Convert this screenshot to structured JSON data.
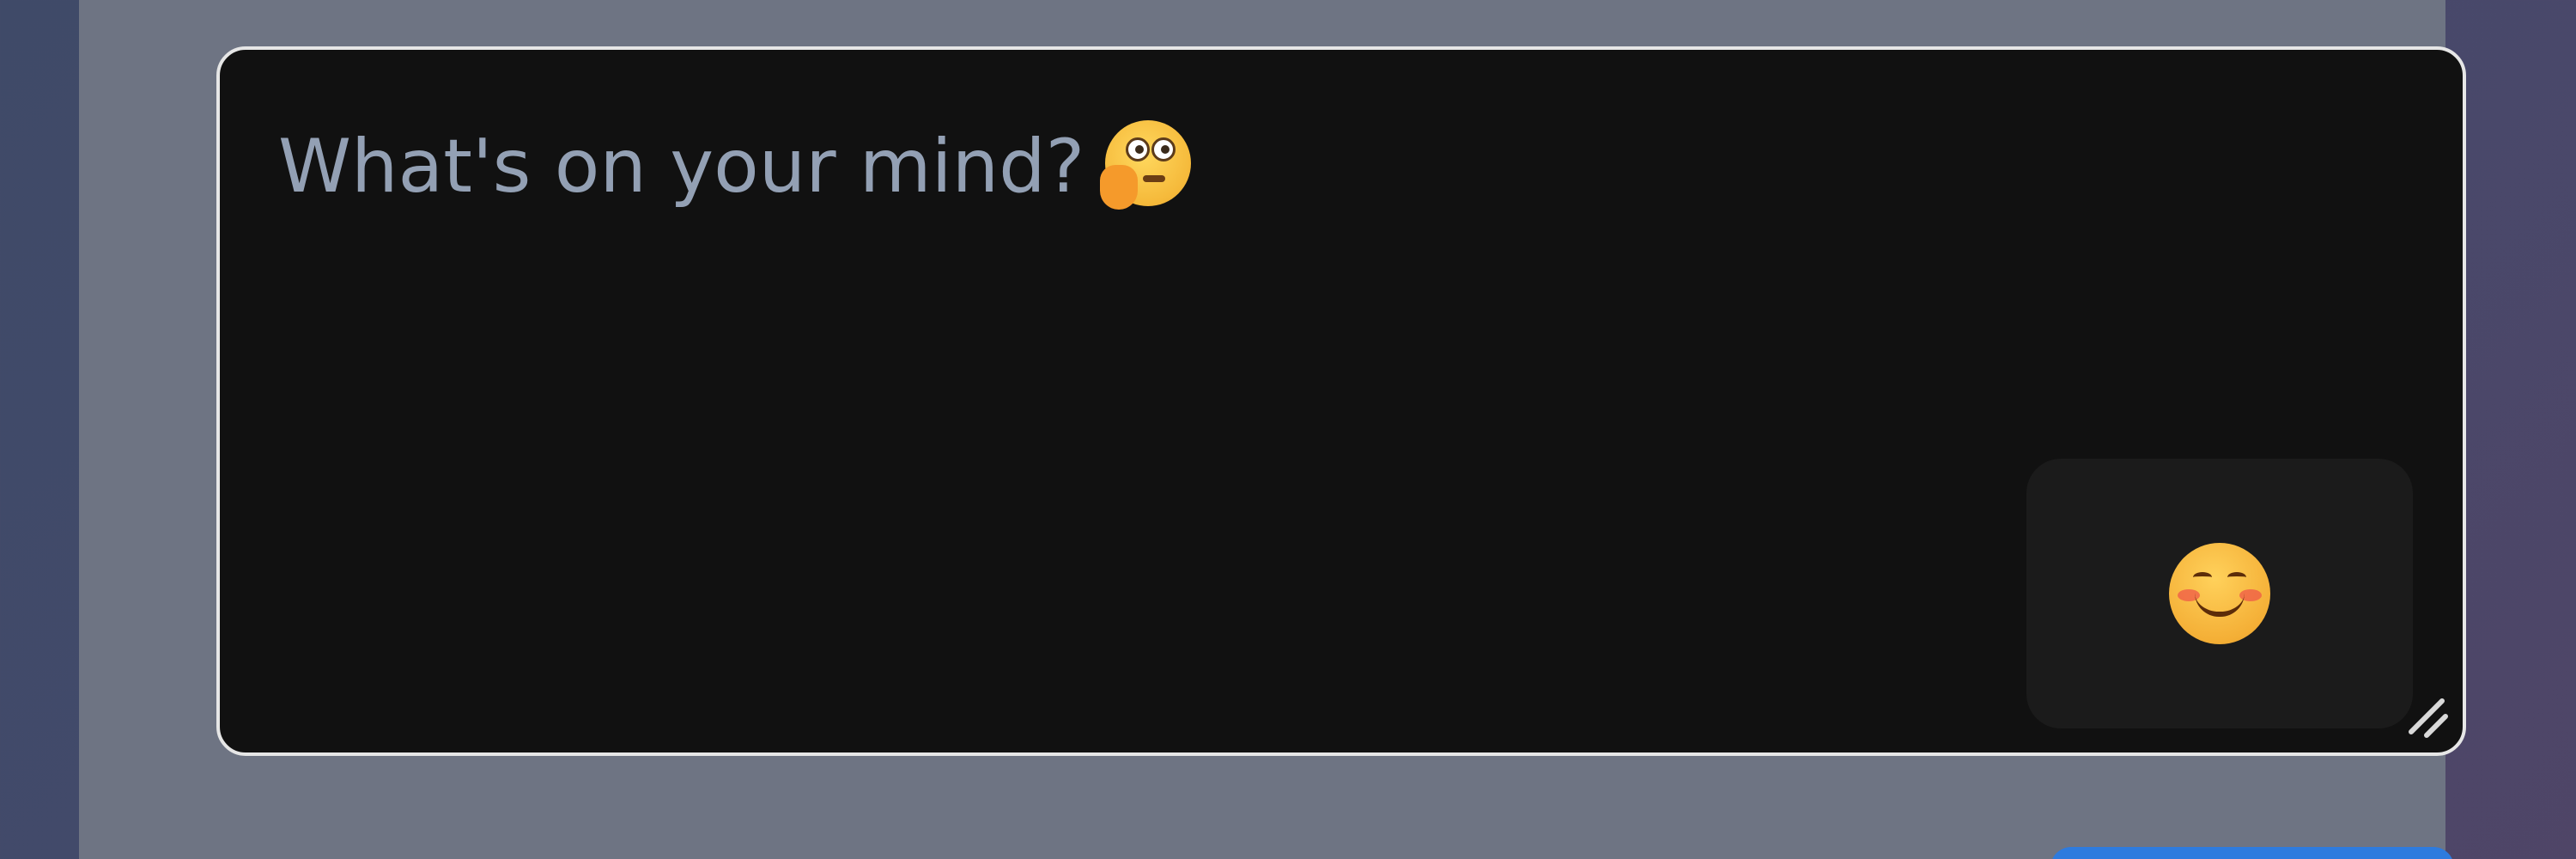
{
  "composer": {
    "placeholder": "What's on your mind?",
    "placeholder_emoji_icon": "thinking-face-icon",
    "emoji_button_icon": "smiling-face-icon"
  },
  "colors": {
    "background": "#454a6c",
    "panel": "#6e7483",
    "textarea_background": "#111111",
    "textarea_border": "#e6e6e6",
    "placeholder_text": "#93a0b4",
    "emoji_button_background": "#1b1b1b",
    "primary_button": "#2e7bde"
  }
}
